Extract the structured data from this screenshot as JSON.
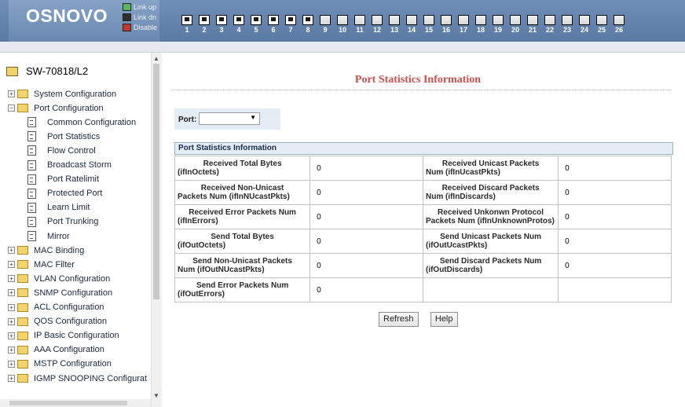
{
  "header": {
    "brand": "OSNOVO",
    "legend": [
      {
        "label": "Link up",
        "state": "up"
      },
      {
        "label": "Link dn",
        "state": "dn"
      },
      {
        "label": "Disable",
        "state": "dis"
      }
    ],
    "ports": [
      {
        "num": "1",
        "linked": true
      },
      {
        "num": "2",
        "linked": true
      },
      {
        "num": "3",
        "linked": true
      },
      {
        "num": "4",
        "linked": true
      },
      {
        "num": "5",
        "linked": true
      },
      {
        "num": "6",
        "linked": true
      },
      {
        "num": "7",
        "linked": true
      },
      {
        "num": "8",
        "linked": true
      },
      {
        "num": "9",
        "linked": false
      },
      {
        "num": "10",
        "linked": false
      },
      {
        "num": "11",
        "linked": false
      },
      {
        "num": "12",
        "linked": false
      },
      {
        "num": "13",
        "linked": false
      },
      {
        "num": "14",
        "linked": false
      },
      {
        "num": "15",
        "linked": false
      },
      {
        "num": "16",
        "linked": false
      },
      {
        "num": "17",
        "linked": false
      },
      {
        "num": "18",
        "linked": false
      },
      {
        "num": "19",
        "linked": false
      },
      {
        "num": "20",
        "linked": false
      },
      {
        "num": "21",
        "linked": false
      },
      {
        "num": "22",
        "linked": false
      },
      {
        "num": "23",
        "linked": false
      },
      {
        "num": "24",
        "linked": false
      },
      {
        "num": "25",
        "linked": false
      },
      {
        "num": "26",
        "linked": false
      }
    ]
  },
  "sidebar": {
    "root": "SW-70818/L2",
    "items": [
      {
        "label": "System Configuration",
        "kind": "folder",
        "indent": 0,
        "expander": "+"
      },
      {
        "label": "Port Configuration",
        "kind": "folder",
        "indent": 0,
        "expander": "-"
      },
      {
        "label": "Common Configuration",
        "kind": "doc",
        "indent": 1
      },
      {
        "label": "Port Statistics",
        "kind": "doc",
        "indent": 1
      },
      {
        "label": "Flow Control",
        "kind": "doc",
        "indent": 1
      },
      {
        "label": "Broadcast Storm",
        "kind": "doc",
        "indent": 1
      },
      {
        "label": "Port Ratelimit",
        "kind": "doc",
        "indent": 1
      },
      {
        "label": "Protected Port",
        "kind": "doc",
        "indent": 1
      },
      {
        "label": "Learn Limit",
        "kind": "doc",
        "indent": 1
      },
      {
        "label": "Port Trunking",
        "kind": "doc",
        "indent": 1
      },
      {
        "label": "Mirror",
        "kind": "doc",
        "indent": 1
      },
      {
        "label": "MAC Binding",
        "kind": "folder",
        "indent": 0,
        "expander": "+"
      },
      {
        "label": "MAC Filter",
        "kind": "folder",
        "indent": 0,
        "expander": "+"
      },
      {
        "label": "VLAN Configuration",
        "kind": "folder",
        "indent": 0,
        "expander": "+"
      },
      {
        "label": "SNMP Configuration",
        "kind": "folder",
        "indent": 0,
        "expander": "+"
      },
      {
        "label": "ACL Configuration",
        "kind": "folder",
        "indent": 0,
        "expander": "+"
      },
      {
        "label": "QOS Configuration",
        "kind": "folder",
        "indent": 0,
        "expander": "+"
      },
      {
        "label": "IP Basic Configuration",
        "kind": "folder",
        "indent": 0,
        "expander": "+"
      },
      {
        "label": "AAA Configuration",
        "kind": "folder",
        "indent": 0,
        "expander": "+"
      },
      {
        "label": "MSTP Configuration",
        "kind": "folder",
        "indent": 0,
        "expander": "+"
      },
      {
        "label": "IGMP SNOOPING Configurat",
        "kind": "folder",
        "indent": 0,
        "expander": "+"
      }
    ]
  },
  "main": {
    "title": "Port Statistics Information",
    "port_label": "Port:",
    "port_value": "",
    "section_header": "Port Statistics Information",
    "rows": [
      [
        {
          "main": "Received Total Bytes",
          "sub": "(ifInOctets)",
          "value": "0"
        },
        {
          "main": "Received Unicast Packets",
          "sub": "Num (ifInUcastPkts)",
          "value": "0"
        }
      ],
      [
        {
          "main": "Received Non-Unicast",
          "sub": "Packets Num (ifInNUcastPkts)",
          "value": "0"
        },
        {
          "main": "Received Discard Packets",
          "sub": "Num (ifInDiscards)",
          "value": "0"
        }
      ],
      [
        {
          "main": "Received Error Packets Num",
          "sub": "(ifInErrors)",
          "value": "0"
        },
        {
          "main": "Received Unkonwn Protocol",
          "sub": "Packets Num (ifInUnknownProtos)",
          "value": "0"
        }
      ],
      [
        {
          "main": "Send Total Bytes",
          "sub": "(ifOutOctets)",
          "value": "0"
        },
        {
          "main": "Send Unicast Packets Num",
          "sub": "(ifOutUcastPkts)",
          "value": "0"
        }
      ],
      [
        {
          "main": "Send Non-Unicast Packets",
          "sub": "Num (ifOutNUcastPkts)",
          "value": "0"
        },
        {
          "main": "Send Discard Packets Num",
          "sub": "(ifOutDiscards)",
          "value": "0"
        }
      ],
      [
        {
          "main": "Send Error Packets Num",
          "sub": "(ifOutErrors)",
          "value": "0"
        },
        {
          "main": "",
          "sub": "",
          "value": ""
        }
      ]
    ],
    "refresh_label": "Refresh",
    "help_label": "Help"
  }
}
